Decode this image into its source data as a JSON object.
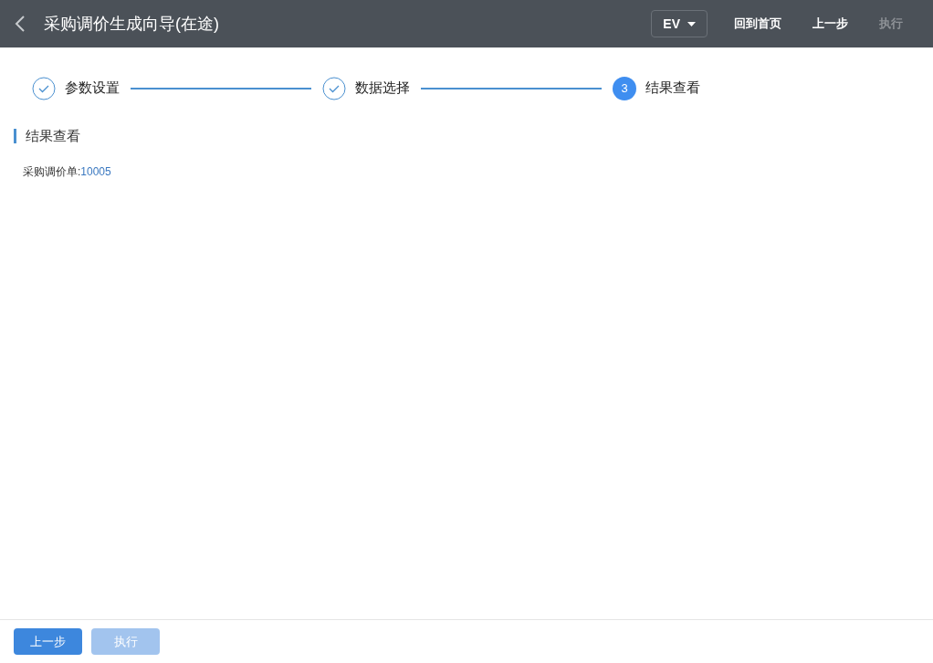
{
  "header": {
    "title": "采购调价生成向导(在途)",
    "dropdown": "EV",
    "actions": [
      {
        "label": "回到首页",
        "disabled": false
      },
      {
        "label": "上一步",
        "disabled": false
      },
      {
        "label": "执行",
        "disabled": true
      }
    ]
  },
  "steps": [
    {
      "label": "参数设置",
      "done": true,
      "selected": false
    },
    {
      "label": "数据选择",
      "done": true,
      "selected": false
    },
    {
      "label": "结果查看",
      "done": false,
      "selected": true,
      "number": "3"
    }
  ],
  "section": {
    "title": "结果查看",
    "field_label": "采购调价单:",
    "field_value": "10005"
  },
  "footer": {
    "buttons": [
      {
        "label": "上一步",
        "disabled": false
      },
      {
        "label": "执行",
        "disabled": true
      }
    ]
  }
}
